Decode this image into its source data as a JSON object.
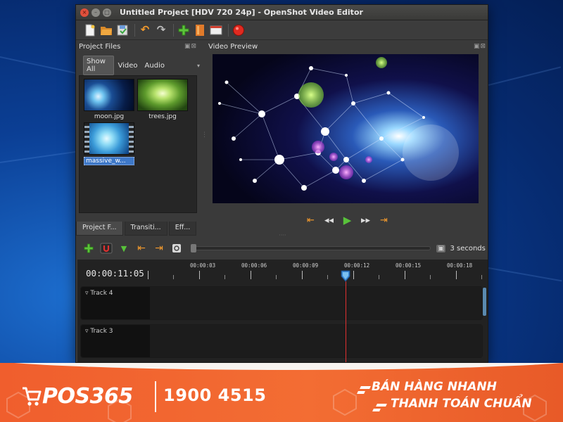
{
  "window": {
    "title": "Untitled Project [HDV 720 24p] - OpenShot Video Editor",
    "buttons": [
      "close-icon",
      "minimize-icon",
      "maximize-icon"
    ]
  },
  "toolbar": {
    "items": [
      "new-project-icon",
      "open-project-icon",
      "save-project-icon",
      "undo-icon",
      "redo-icon",
      "import-files-icon",
      "choose-profile-icon",
      "fullscreen-icon",
      "export-video-icon"
    ]
  },
  "project_files": {
    "title": "Project Files",
    "filters": [
      "Show All",
      "Video",
      "Audio"
    ],
    "files": [
      {
        "name": "moon.jpg"
      },
      {
        "name": "trees.jpg"
      },
      {
        "name": "massive_w..."
      }
    ],
    "tabs": [
      "Project F...",
      "Transiti...",
      "Eff..."
    ]
  },
  "video_preview": {
    "title": "Video Preview",
    "controls": [
      "jump-start-icon",
      "rewind-icon",
      "play-icon",
      "fast-forward-icon",
      "jump-end-icon"
    ]
  },
  "timeline_toolbar": {
    "items": [
      "add-track-icon",
      "snapping-icon",
      "add-marker-icon",
      "previous-marker-icon",
      "next-marker-icon",
      "center-timeline-icon"
    ],
    "zoom_label": "3 seconds"
  },
  "timeline": {
    "timecode": "00:00:11:05",
    "ticks": [
      "00:00:03",
      "00:00:06",
      "00:00:09",
      "00:00:12",
      "00:00:15",
      "00:00:18"
    ],
    "tracks": [
      {
        "name": "Track 4"
      },
      {
        "name": "Track 3"
      }
    ]
  },
  "banner": {
    "brand": "POS365",
    "phone": "1900 4515",
    "slogan_line1": "BÁN HÀNG NHANH",
    "slogan_line2": "THANH TOÁN CHUẨN",
    "colors": {
      "primary": "#f05e2d",
      "text": "#ffffff"
    }
  }
}
